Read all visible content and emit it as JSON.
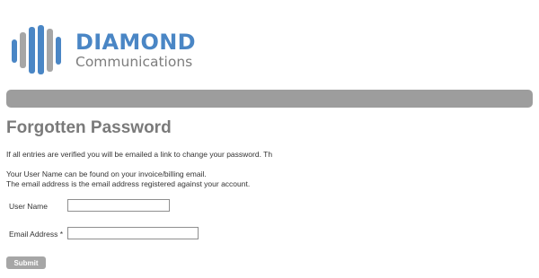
{
  "brand": {
    "name": "DIAMOND",
    "tagline": "Communications",
    "colors": {
      "primary": "#4a86c5",
      "secondary": "#aaaaaa"
    }
  },
  "page": {
    "title": "Forgotten Password",
    "intro": "If all entries are verified you will be emailed a link to change your password. Th",
    "hint_line1": "Your User Name can be found on your invoice/billing email.",
    "hint_line2": "The email address is the email address registered against your account."
  },
  "form": {
    "username": {
      "label": "User Name",
      "value": "",
      "placeholder": ""
    },
    "email": {
      "label": "Email Address *",
      "value": "",
      "placeholder": ""
    },
    "submit_label": "Submit"
  }
}
